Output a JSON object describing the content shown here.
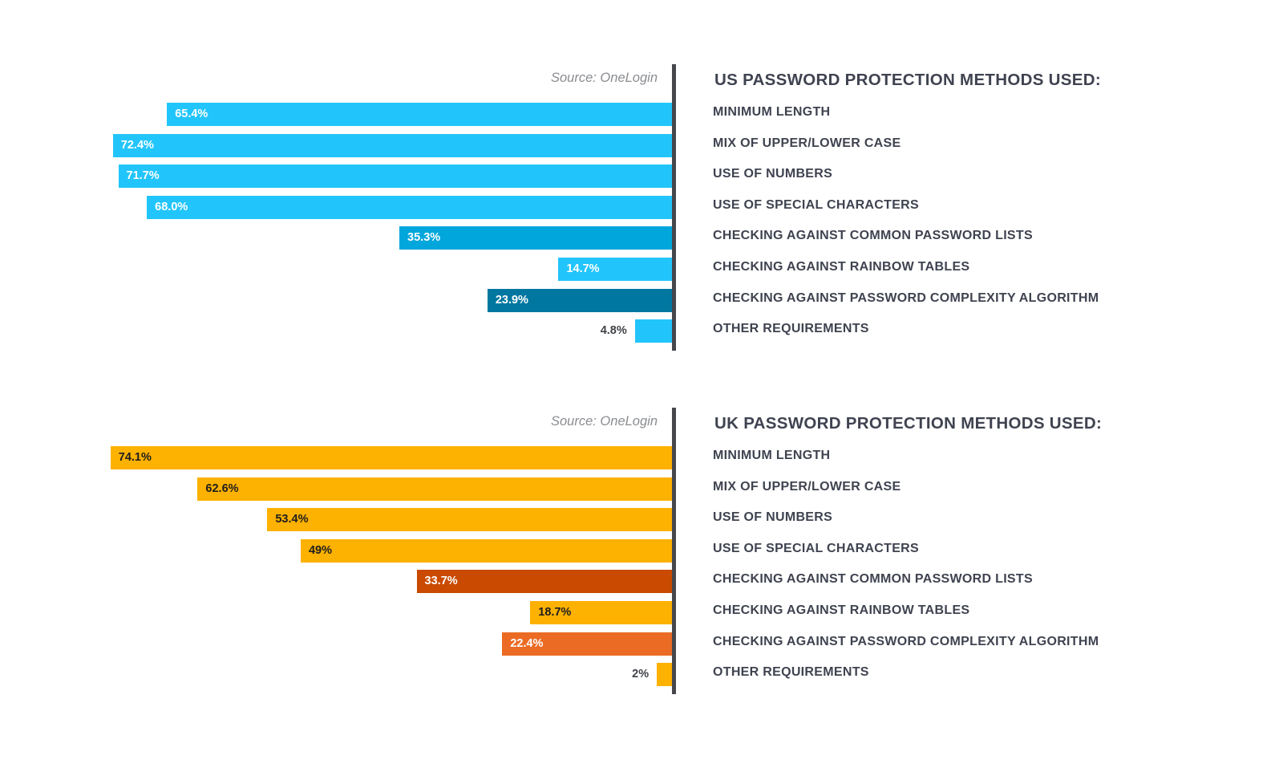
{
  "chart_data": [
    {
      "type": "bar",
      "orientation": "horizontal",
      "title": "US PASSWORD PROTECTION METHODS USED:",
      "source": "Source: OneLogin",
      "categories": [
        "MINIMUM LENGTH",
        "MIX OF UPPER/LOWER CASE",
        "USE OF NUMBERS",
        "USE OF SPECIAL CHARACTERS",
        "CHECKING AGAINST COMMON PASSWORD LISTS",
        "CHECKING AGAINST RAINBOW TABLES",
        "CHECKING AGAINST PASSWORD COMPLEXITY ALGORITHM",
        "OTHER REQUIREMENTS"
      ],
      "values": [
        65.4,
        72.4,
        71.7,
        68.0,
        35.3,
        14.7,
        23.9,
        4.8
      ],
      "labels": [
        "65.4%",
        "72.4%",
        "71.7%",
        "68.0%",
        "35.3%",
        "14.7%",
        "23.9%",
        "4.8%"
      ],
      "colors": [
        "#22c5fb",
        "#22c5fb",
        "#22c5fb",
        "#22c5fb",
        "#00a6dc",
        "#22c5fb",
        "#0077a0",
        "#22c5fb"
      ],
      "label_colors": [
        "#ffffff",
        "#ffffff",
        "#ffffff",
        "#ffffff",
        "#ffffff",
        "#ffffff",
        "#ffffff",
        "#3f4247"
      ],
      "grid": false
    },
    {
      "type": "bar",
      "orientation": "horizontal",
      "title": "UK PASSWORD PROTECTION METHODS USED:",
      "source": "Source: OneLogin",
      "categories": [
        "MINIMUM LENGTH",
        "MIX OF UPPER/LOWER CASE",
        "USE OF NUMBERS",
        "USE OF SPECIAL CHARACTERS",
        "CHECKING AGAINST COMMON PASSWORD LISTS",
        "CHECKING AGAINST RAINBOW TABLES",
        "CHECKING AGAINST PASSWORD COMPLEXITY ALGORITHM",
        "OTHER REQUIREMENTS"
      ],
      "values": [
        74.1,
        62.6,
        53.4,
        49,
        33.7,
        18.7,
        22.4,
        2
      ],
      "labels": [
        "74.1%",
        "62.6%",
        "53.4%",
        "49%",
        "33.7%",
        "18.7%",
        "22.4%",
        "2%"
      ],
      "colors": [
        "#fdb100",
        "#fdb100",
        "#fdb100",
        "#fdb100",
        "#c94a00",
        "#fdb100",
        "#eb6b24",
        "#fdb100"
      ],
      "label_colors": [
        "#1e1e1e",
        "#1e1e1e",
        "#1e1e1e",
        "#1e1e1e",
        "#ffffff",
        "#1e1e1e",
        "#ffffff",
        "#3f4247"
      ],
      "grid": false
    }
  ]
}
